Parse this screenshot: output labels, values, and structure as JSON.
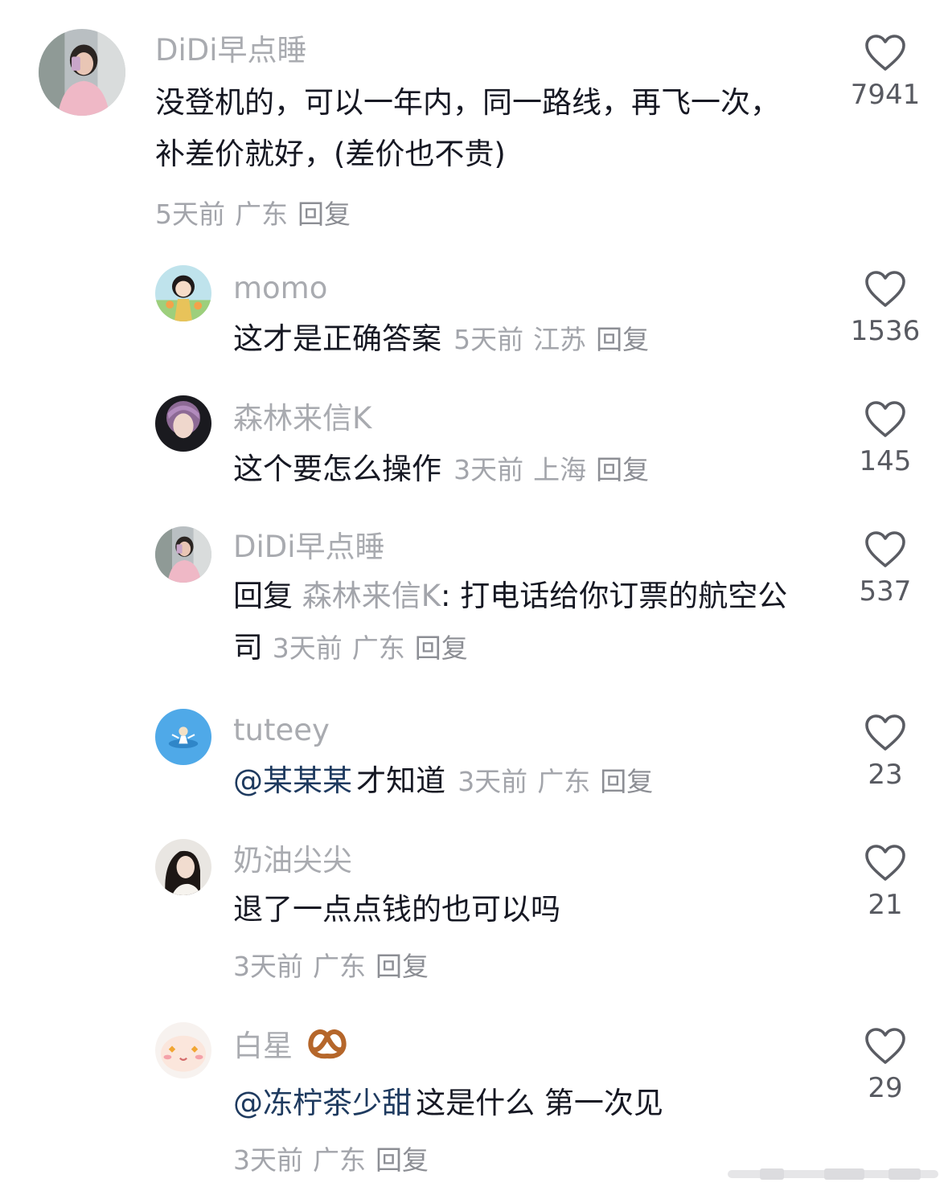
{
  "comments": [
    {
      "username": "DiDi早点睡",
      "text": "没登机的，可以一年内，同一路线，再飞一次，补差价就好，(差价也不贵)",
      "time": "5天前",
      "location": "广东",
      "reply": "回复",
      "likes": "7941",
      "avatar_icon": "avatar-woman-pink-top"
    },
    {
      "username": "momo",
      "text": "这才是正确答案",
      "time": "5天前",
      "location": "江苏",
      "reply": "回复",
      "likes": "1536",
      "avatar_icon": "avatar-cartoon-girl"
    },
    {
      "username": "森林来信K",
      "text": "这个要怎么操作",
      "time": "3天前",
      "location": "上海",
      "reply": "回复",
      "likes": "145",
      "avatar_icon": "avatar-purple-hair"
    },
    {
      "username": "DiDi早点睡",
      "reply_prefix": "回复",
      "reply_to": "森林来信K",
      "reply_sep": ":",
      "text": "打电话给你订票的航空公司",
      "time": "3天前",
      "location": "广东",
      "reply": "回复",
      "likes": "537",
      "avatar_icon": "avatar-woman-pink-top"
    },
    {
      "username": "tuteey",
      "mention": "@某某某",
      "text": "才知道",
      "time": "3天前",
      "location": "广东",
      "reply": "回复",
      "likes": "23",
      "avatar_icon": "avatar-blue-circle"
    },
    {
      "username": "奶油尖尖",
      "text": "退了一点点钱的也可以吗",
      "time": "3天前",
      "location": "广东",
      "reply": "回复",
      "likes": "21",
      "avatar_icon": "avatar-long-hair-woman"
    },
    {
      "username": "白星",
      "username_emoji": "pretzel-icon",
      "mention": "@冻柠茶少甜",
      "text": "这是什么 第一次见",
      "time": "3天前",
      "location": "广东",
      "reply": "回复",
      "likes": "29",
      "avatar_icon": "avatar-cartoon-face"
    }
  ],
  "colors": {
    "username": "#a9abb0",
    "text": "#161823",
    "meta": "#a3a5ab",
    "mention": "#1e3a5f",
    "heart": "#5a5c63"
  }
}
